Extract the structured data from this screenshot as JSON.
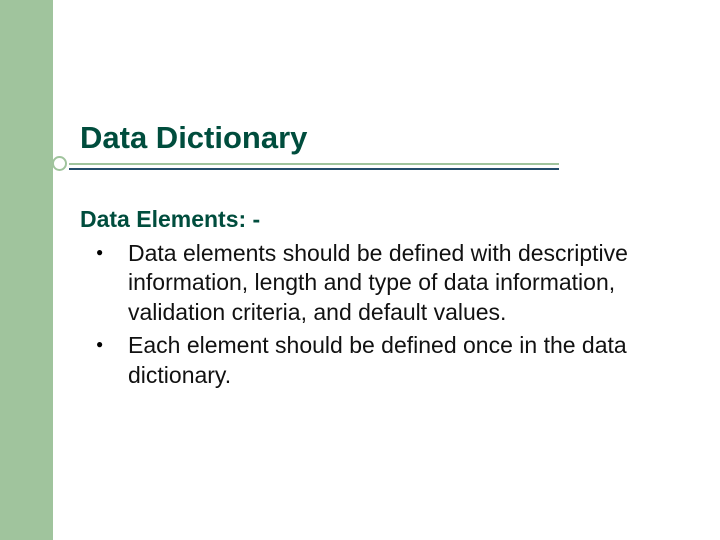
{
  "slide": {
    "title": "Data Dictionary",
    "subheading": "Data Elements: -",
    "bullets": [
      "Data elements should be defined with descriptive information, length and type of data information, validation criteria, and default values.",
      "Each element should be defined once in the data dictionary."
    ]
  }
}
